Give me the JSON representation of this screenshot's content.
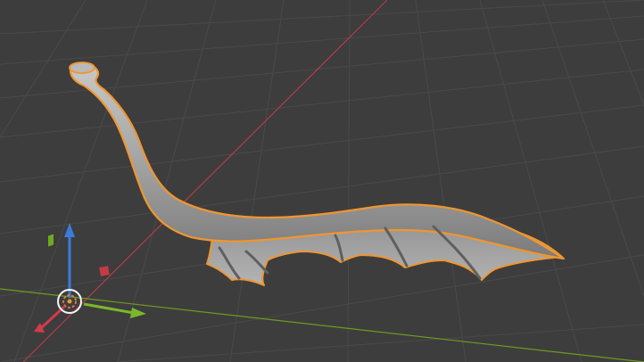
{
  "viewport": {
    "name": "3D Viewport",
    "background": "#3d3d3d",
    "grid_color": "#4a4a4a",
    "x_axis_color": "#b43b45",
    "y_axis_color": "#6f9b1f"
  },
  "selected_object": {
    "kind": "tail mesh with membrane fin",
    "surface_color": "#a9a9a9",
    "outline_color": "#f0962e",
    "selected": true
  },
  "gizmo": {
    "z_arrow_color": "#3c7bdc",
    "y_arrow_color": "#7ab82a",
    "x_arrow_color": "#d43a4a",
    "pivot_icon": "transform-pivot-icon"
  }
}
